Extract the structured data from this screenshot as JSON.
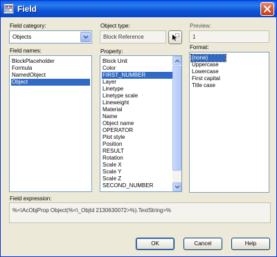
{
  "window": {
    "title": "Field"
  },
  "field_category": {
    "label": "Field category:",
    "selected": "Objects"
  },
  "field_names": {
    "label": "Field names:",
    "items": [
      "BlockPlaceholder",
      "Formula",
      "NamedObject",
      "Object"
    ],
    "selected_index": 3
  },
  "object_type": {
    "label": "Object type:",
    "value": "Block Reference"
  },
  "property": {
    "label": "Property:",
    "items": [
      "Block Unit",
      "Color",
      "FIRST_NUMBER",
      "Layer",
      "Linetype",
      "Linetype scale",
      "Lineweight",
      "Material",
      "Name",
      "Object name",
      "OPERATOR",
      "Plot style",
      "Position",
      "RESULT",
      "Rotation",
      "Scale X",
      "Scale Y",
      "Scale Z",
      "SECOND_NUMBER"
    ],
    "selected_index": 2
  },
  "preview": {
    "label": "Preview:",
    "value": "1"
  },
  "format": {
    "label": "Format:",
    "items": [
      "(none)",
      "Uppercase",
      "Lowercase",
      "First capital",
      "Title case"
    ],
    "selected_index": 0
  },
  "field_expression": {
    "label": "Field expression:",
    "value": "%<\\AcObjProp Object(%<\\_ObjId 2130630072>%).TextString>%"
  },
  "buttons": {
    "ok": "OK",
    "cancel": "Cancel",
    "help": "Help"
  },
  "colors": {
    "selection": "#316ac5",
    "title_bar": "#0a5fe6",
    "dialog_bg": "#ece9d8"
  }
}
